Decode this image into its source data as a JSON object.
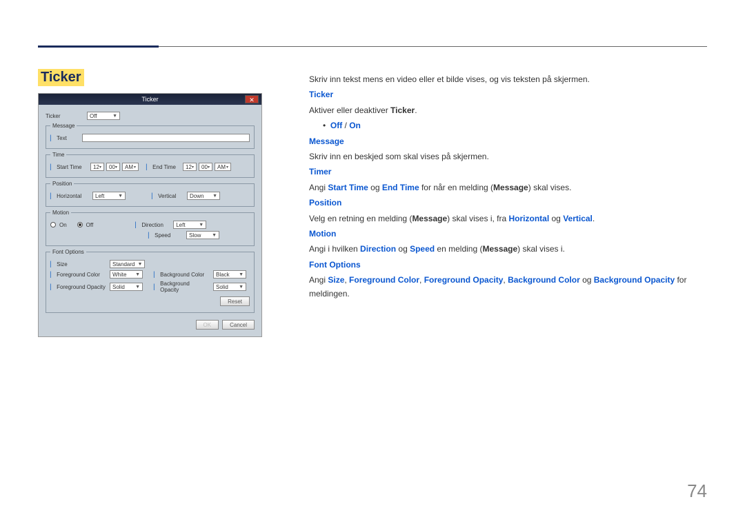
{
  "title": "Ticker",
  "page_number": "74",
  "dialog": {
    "title": "Ticker",
    "close": "✕",
    "ticker_label": "Ticker",
    "ticker_value": "Off",
    "message_legend": "Message",
    "text_label": "Text",
    "time_legend": "Time",
    "start_time_label": "Start Time",
    "start_h": "12",
    "start_m": "00",
    "start_ampm": "AM",
    "end_time_label": "End Time",
    "end_h": "12",
    "end_m": "00",
    "end_ampm": "AM",
    "position_legend": "Position",
    "horizontal_label": "Horizontal",
    "horizontal_value": "Left",
    "vertical_label": "Vertical",
    "vertical_value": "Down",
    "motion_legend": "Motion",
    "on_label": "On",
    "off_label": "Off",
    "direction_label": "Direction",
    "direction_value": "Left",
    "speed_label": "Speed",
    "speed_value": "Slow",
    "font_legend": "Font Options",
    "size_label": "Size",
    "size_value": "Standard",
    "fg_color_label": "Foreground Color",
    "fg_color_value": "White",
    "bg_color_label": "Background Color",
    "bg_color_value": "Black",
    "fg_opacity_label": "Foreground Opacity",
    "fg_opacity_value": "Solid",
    "bg_opacity_label": "Background Opacity",
    "bg_opacity_value": "Solid",
    "reset_button": "Reset",
    "ok_button": "OK",
    "cancel_button": "Cancel"
  },
  "doc": {
    "intro": "Skriv inn tekst mens en video eller et bilde vises, og vis teksten på skjermen.",
    "h_ticker": "Ticker",
    "ticker_desc_pre": "Aktiver eller deaktiver ",
    "ticker_desc_bold": "Ticker",
    "ticker_desc_post": ".",
    "off": "Off",
    "on": "On",
    "slash": " / ",
    "h_message": "Message",
    "message_desc": "Skriv inn en beskjed som skal vises på skjermen.",
    "h_timer": "Timer",
    "timer_pre": "Angi ",
    "start_time": "Start Time",
    "og": " og ",
    "end_time": "End Time",
    "timer_mid": " for når en melding (",
    "msg_bold": "Message",
    "timer_post": ") skal vises.",
    "h_position": "Position",
    "position_pre": "Velg en retning en melding (",
    "position_mid": ") skal vises i, fra ",
    "horizontal": "Horizontal",
    "vertical": "Vertical",
    "period": ".",
    "h_motion": "Motion",
    "motion_pre": "Angi i hvilken ",
    "direction": "Direction",
    "speed": "Speed",
    "motion_mid": " en melding (",
    "motion_post": ") skal vises i.",
    "h_font": "Font Options",
    "font_pre": "Angi ",
    "size": "Size",
    "comma": ", ",
    "fg_color": "Foreground Color",
    "fg_opacity": "Foreground Opacity",
    "bg_color": "Background Color",
    "bg_opacity": "Background Opacity",
    "font_post": " for meldingen."
  }
}
